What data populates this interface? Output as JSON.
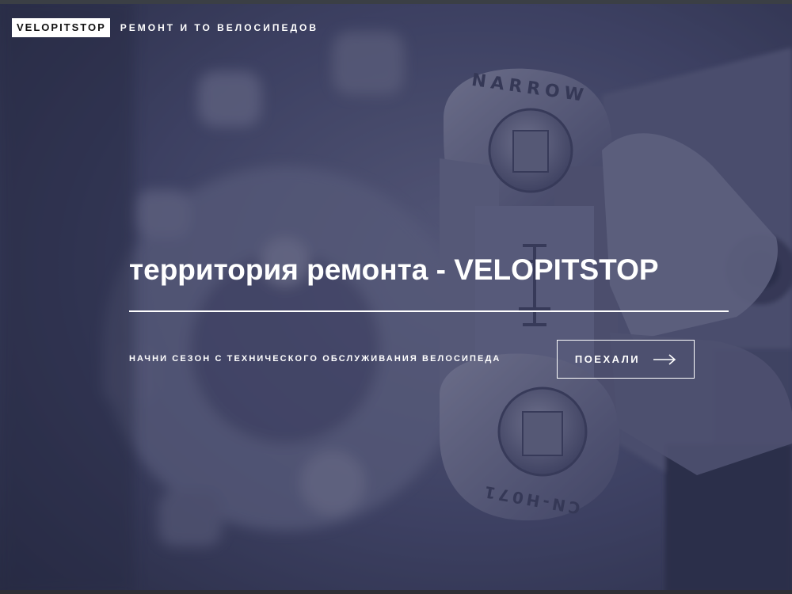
{
  "header": {
    "logo_text": "VELOPITSTOP",
    "tagline": "РЕМОНТ И ТО ВЕЛОСИПЕДОВ"
  },
  "hero": {
    "headline": "территория ремонта - VELOPITSTOP",
    "subline": "НАЧНИ СЕЗОН С ТЕХНИЧЕСКОГО ОБСЛУЖИВАНИЯ ВЕЛОСИПЕДА",
    "cta_label": "ПОЕХАЛИ",
    "chain_top_text": "NARROW",
    "chain_bottom_text": "CN-H071"
  },
  "icons": {
    "cta_icon": "arrow-right-icon"
  },
  "colors": {
    "overlay": "#2e3252",
    "text": "#ffffff",
    "logo_bg": "#ffffff",
    "logo_text": "#111111"
  }
}
